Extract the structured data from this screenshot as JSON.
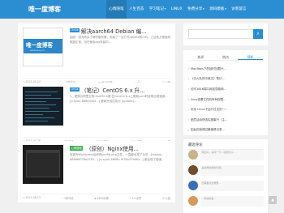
{
  "site": {
    "logo": "唯一度博客"
  },
  "nav": [
    {
      "label": "心情随笔",
      "active": true
    },
    {
      "label": "人生百态"
    },
    {
      "label": "学习笔记",
      "caret": "▾"
    },
    {
      "label": "LINUX"
    },
    {
      "label": "免费分享",
      "caret": "▾"
    },
    {
      "label": "源码模板",
      "caret": "▾"
    },
    {
      "label": "访客留言"
    }
  ],
  "articles": [
    {
      "category": "Linux",
      "title": "解决aarch64 Debian 编...",
      "excerpt": "起因：因为购买了新的服务器，安装了一台打开ARM64的ntfs，之后各方面使用都挺正常，但在使用apt安装时...",
      "thumb": {
        "logo": "唯一度博客",
        "url": "www.s1cy.cn"
      },
      "meta": {
        "date": "2023-03-24",
        "comments": "3条评论",
        "views": "2620阅读",
        "likes": "2",
        "author": "六度"
      }
    },
    {
      "category": "Linux",
      "title": "（笔记）CentOS 6.x 升...",
      "excerpt": "1、更换为阿里云的CentOS 6源 在CentOS 6.x上更新yum时经常出现错误... [crayon-6866d405...] 更新完成后执行 [update]...",
      "meta": {
        "date": "2021-07-28",
        "comments": "9条评论",
        "views": "2311阅读",
        "likes": "5人点赞",
        "author": "六度"
      }
    },
    {
      "category": "心情随笔",
      "title": "（原创）Nginx使用...",
      "excerpt": "安装完Wordpress后修改config.php文件，一直都出现了无法...[crayon-68666f078a4781...] [crayon-6866b f078a479864...] 都出现了错误...",
      "meta": {
        "date": "2021-06-23",
        "comments": "1条评论",
        "views": "1645阅读",
        "likes": "1人点赞",
        "author": "六度"
      }
    }
  ],
  "search": {
    "placeholder": "",
    "button": "⌕"
  },
  "hot_tabs": [
    "热评",
    "热点",
    "随机"
  ],
  "hot_list": [
    "MooTools下的延时加载代...",
    "《灭火队的中英文》笔记...",
    "访问1616端口网站导致网...",
    "linux查看文件的所有权限...",
    "优化 Linux下运行日志的一...",
    "团员活动获选实施事兴（主...",
    "如此的我博过最值得记录..."
  ],
  "recent": {
    "title": "最近评论",
    "comments": [
      "博主好，请问一下...功能可以...",
      "是这样的我的问题...",
      "还需要点击哪里...",
      "...你说的是..."
    ]
  },
  "colors": {
    "primary": "#2b8ed3",
    "green": "#3eaa4d"
  }
}
